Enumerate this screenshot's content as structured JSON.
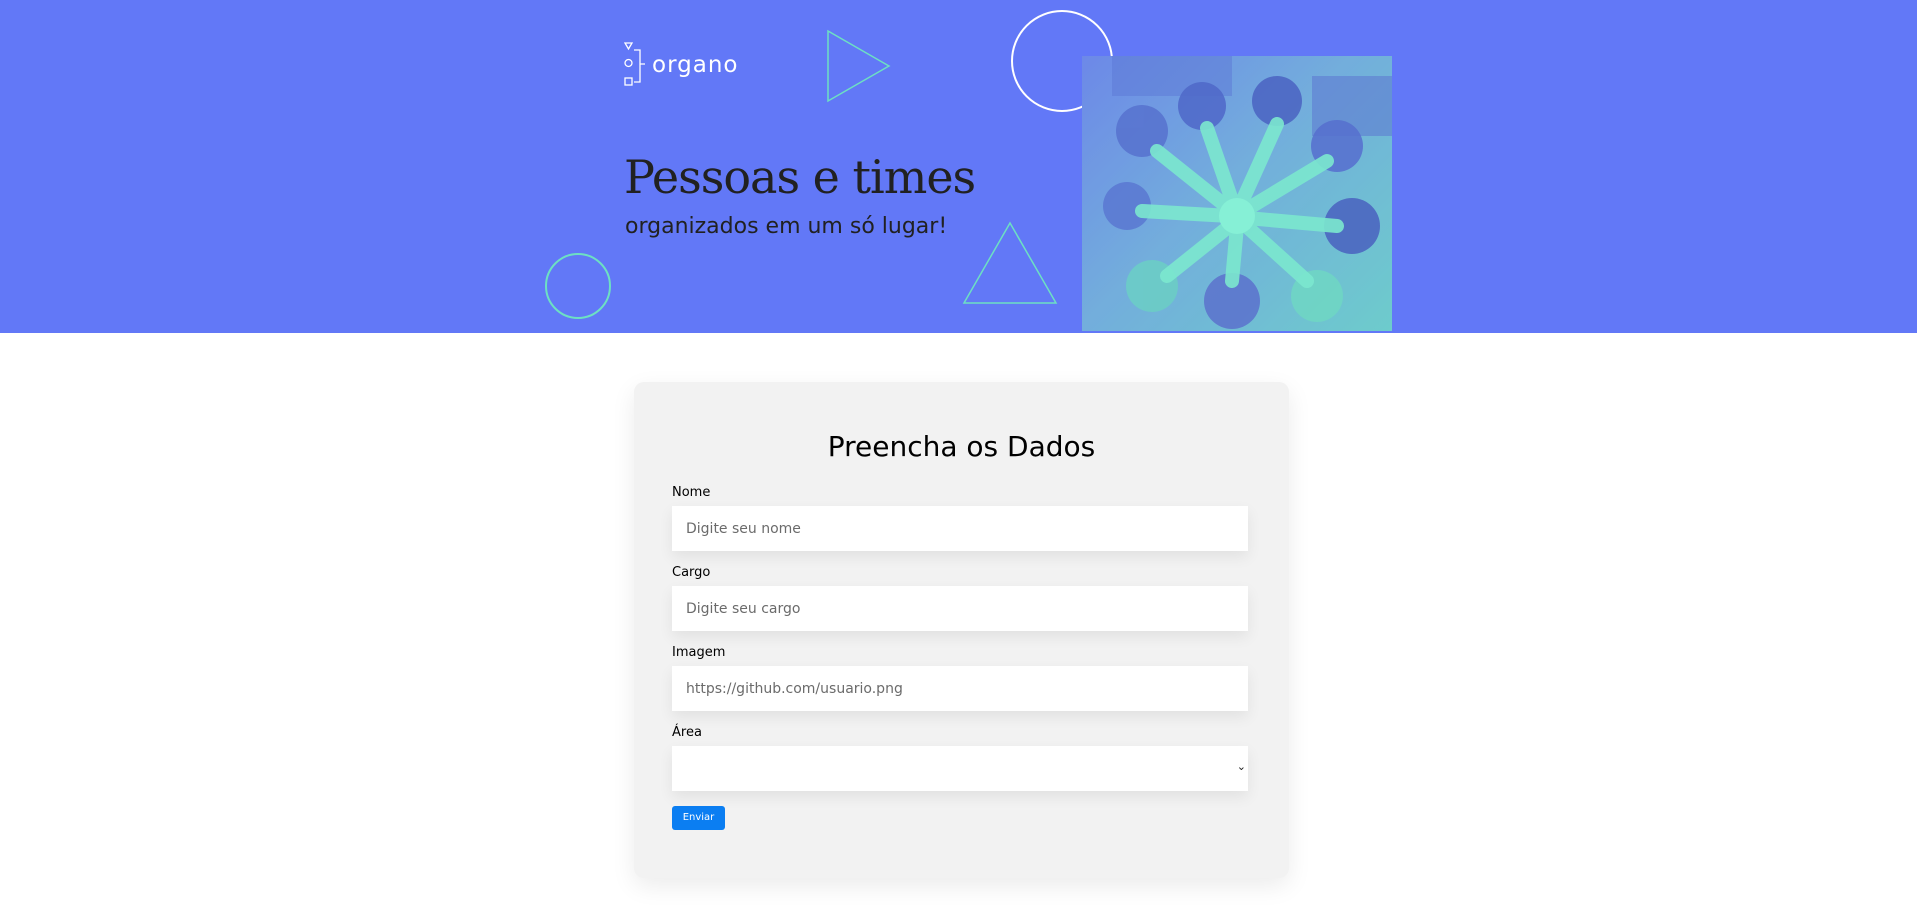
{
  "header": {
    "logo_text": "organo",
    "title": "Pessoas e times",
    "subtitle": "organizados em um só lugar!",
    "accent_color": "#6278f7",
    "decoration_color": "#6de0c3"
  },
  "form": {
    "title": "Preencha os Dados",
    "fields": [
      {
        "label": "Nome",
        "placeholder": "Digite seu nome",
        "value": ""
      },
      {
        "label": "Cargo",
        "placeholder": "Digite seu cargo",
        "value": ""
      },
      {
        "label": "Imagem",
        "placeholder": "https://github.com/usuario.png",
        "value": ""
      }
    ],
    "select": {
      "label": "Área",
      "value": "",
      "icon": "chevron-down-icon"
    },
    "submit_label": "Enviar",
    "submit_color": "#0b7ef2"
  }
}
